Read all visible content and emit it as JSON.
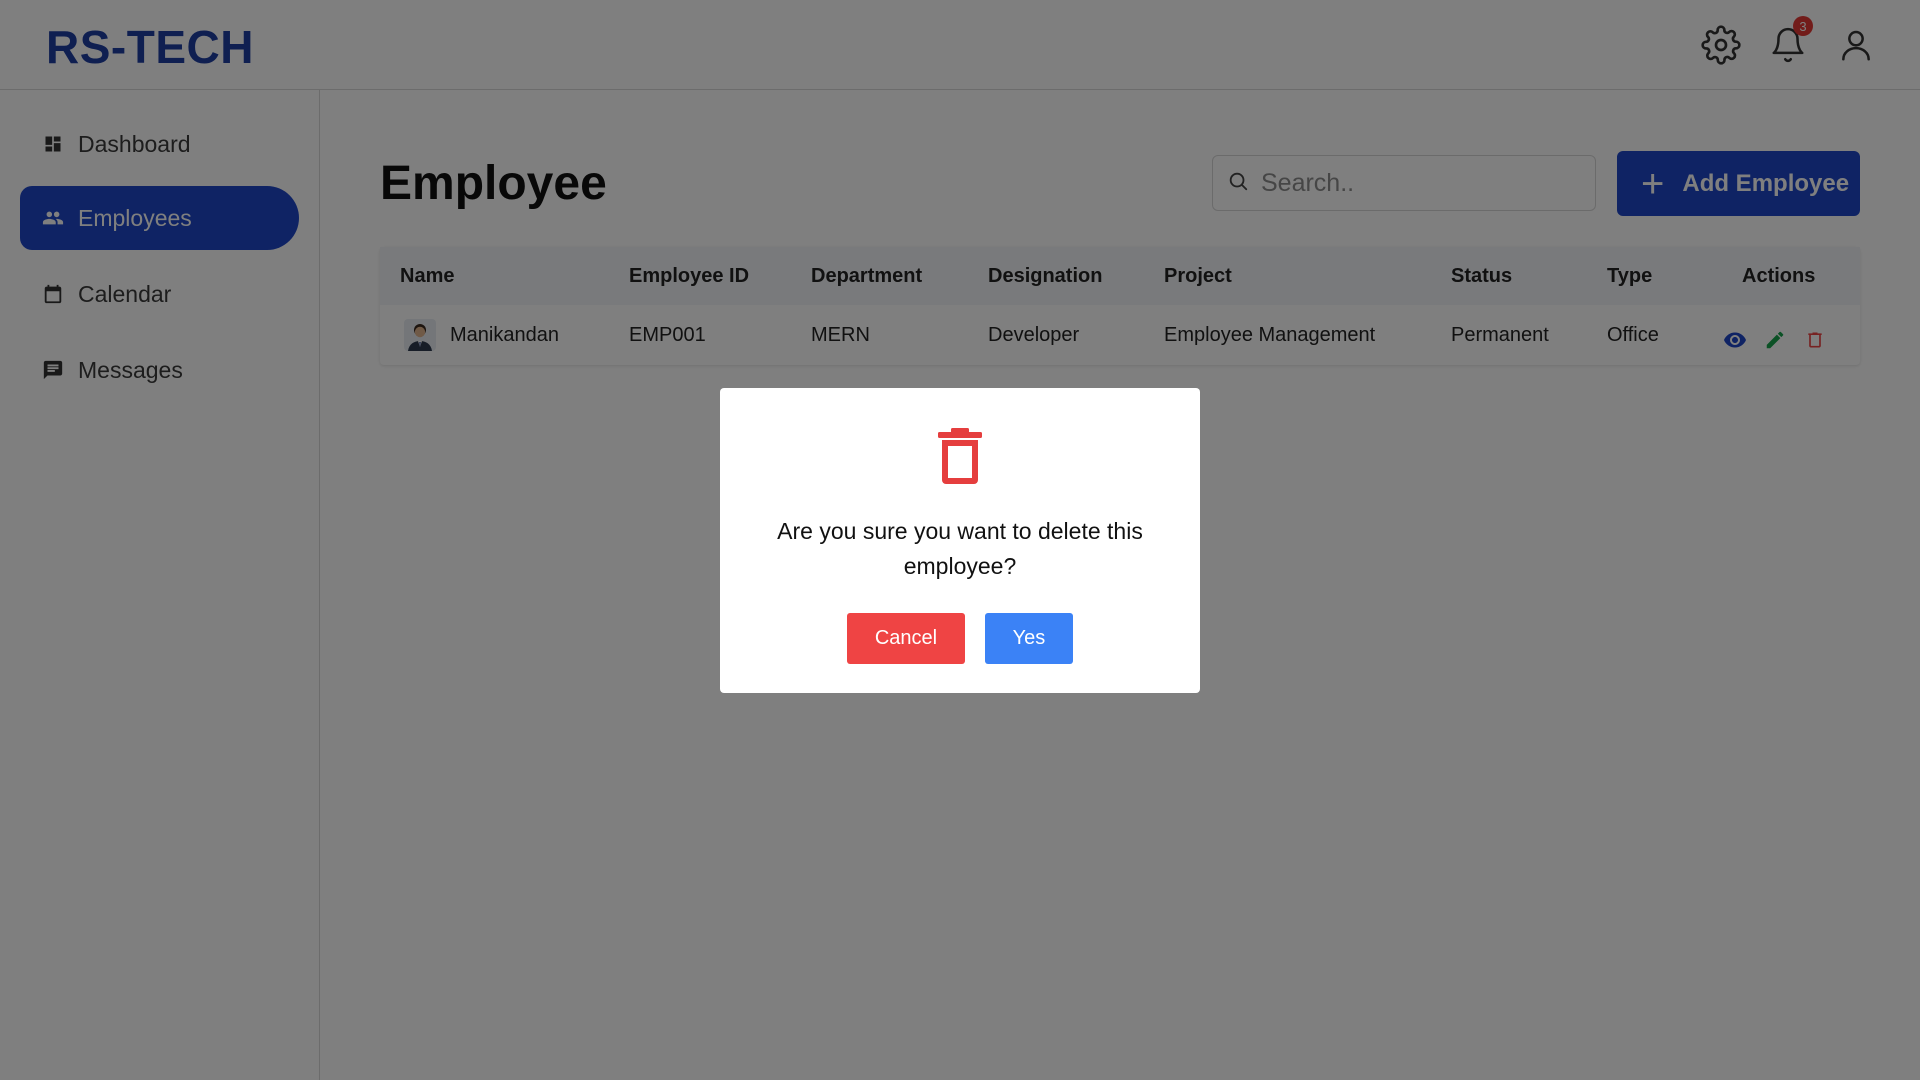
{
  "header": {
    "logo": "RS-TECH",
    "icons": [
      "gear-icon",
      "bell-icon",
      "user-icon"
    ],
    "notification_count": "3"
  },
  "sidebar": {
    "items": [
      {
        "label": "Dashboard",
        "icon": "dashboard-icon",
        "active": false
      },
      {
        "label": "Employees",
        "icon": "people-icon",
        "active": true
      },
      {
        "label": "Calendar",
        "icon": "calendar-icon",
        "active": false
      },
      {
        "label": "Messages",
        "icon": "message-icon",
        "active": false
      }
    ]
  },
  "main": {
    "title": "Employee",
    "search": {
      "placeholder": "Search..",
      "value": ""
    },
    "add_button": "Add Employee",
    "table": {
      "headers": [
        "Name",
        "Employee ID",
        "Department",
        "Designation",
        "Project",
        "Status",
        "Type",
        "Actions"
      ],
      "rows": [
        {
          "name": "Manikandan",
          "employee_id": "EMP001",
          "department": "MERN",
          "designation": "Developer",
          "project": "Employee Management",
          "status": "Permanent",
          "type": "Office",
          "actions": [
            "eye-icon",
            "pencil-icon",
            "trash-icon"
          ]
        }
      ]
    }
  },
  "modal": {
    "icon": "trash-icon",
    "message": "Are you sure you want to delete this employee?",
    "cancel_label": "Cancel",
    "confirm_label": "Yes"
  },
  "colors": {
    "brand": "#1e47c8",
    "logo": "#1f3fa3",
    "danger": "#ef4444",
    "confirm": "#3b82f6",
    "view_icon": "#1e47c8",
    "edit_icon": "#16a34a",
    "delete_icon": "#ef4444"
  }
}
